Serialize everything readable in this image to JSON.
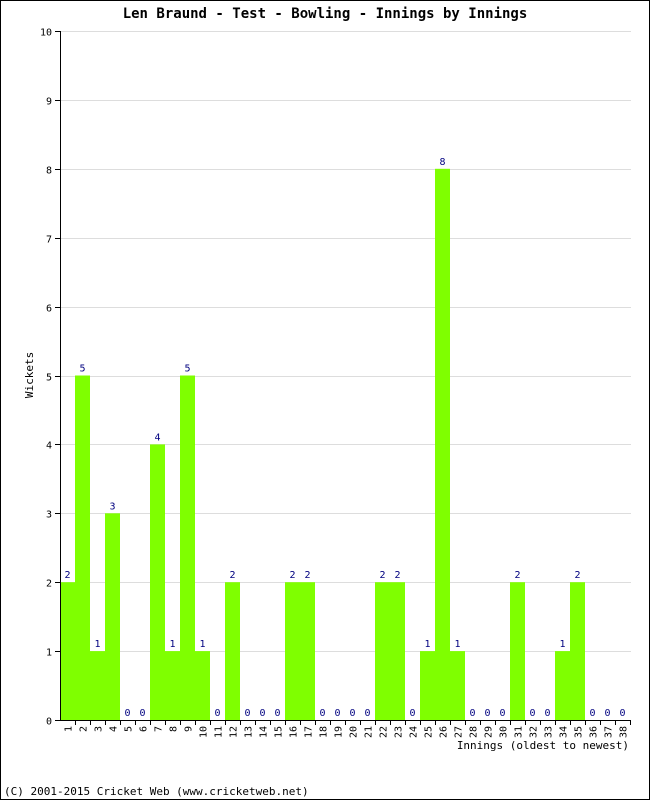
{
  "chart_data": {
    "type": "bar",
    "title": "Len Braund - Test - Bowling - Innings by Innings",
    "xlabel": "Innings (oldest to newest)",
    "ylabel": "Wickets",
    "ylim": [
      0,
      10
    ],
    "yticks": [
      0,
      1,
      2,
      3,
      4,
      5,
      6,
      7,
      8,
      9,
      10
    ],
    "grid": true,
    "categories": [
      "1",
      "2",
      "3",
      "4",
      "5",
      "6",
      "7",
      "8",
      "9",
      "10",
      "11",
      "12",
      "13",
      "14",
      "15",
      "16",
      "17",
      "18",
      "19",
      "20",
      "21",
      "22",
      "23",
      "24",
      "25",
      "26",
      "27",
      "28",
      "29",
      "30",
      "31",
      "32",
      "33",
      "34",
      "35",
      "36",
      "37",
      "38"
    ],
    "values": [
      2,
      5,
      1,
      3,
      0,
      0,
      4,
      1,
      5,
      1,
      0,
      2,
      0,
      0,
      0,
      2,
      2,
      0,
      0,
      0,
      0,
      2,
      2,
      0,
      1,
      8,
      1,
      0,
      0,
      0,
      2,
      0,
      0,
      1,
      2,
      0,
      0,
      0
    ],
    "bar_color": "#7fff00",
    "label_color": "#000080"
  },
  "footer": "(C) 2001-2015 Cricket Web (www.cricketweb.net)"
}
